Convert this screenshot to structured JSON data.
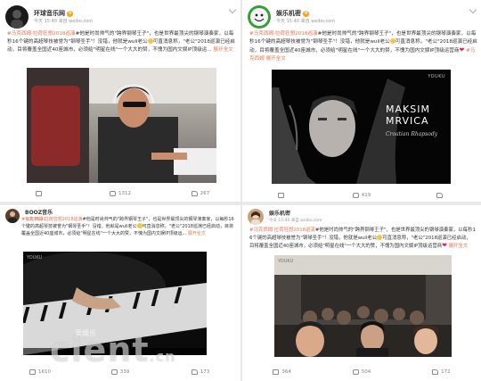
{
  "posts": [
    {
      "username": "环球音乐网",
      "verified": "V",
      "time": "今天 15:40",
      "source": "来自 weibo.com",
      "text_prefix": "#",
      "tag": "马克西姆·拉荷狂想2018巡演",
      "text": "#他是时尚帅气的\"跨界钢琴王子\"，也是世界最顶尖的钢琴演奏家，以每秒16个键的高超琴技被誉为\"钢琴圣手\"！没错，他就是wuli老公",
      "text2": "可直消息称，\"老公\"2018巡演已经启动，目将覆盖全国近40座城市，必须给\"明星在线\"一个大大的赞，不愧为国内文娱IP顶级运...",
      "more": "展开全文",
      "actions": {
        "share": "",
        "comment": "1312",
        "like": "267"
      },
      "avatar_color": "#1a1a1a"
    },
    {
      "username": "娱乐机密",
      "verified": "V",
      "time": "今天 15:40",
      "source": "来自 weibo.com",
      "text_prefix": "#",
      "tag": "马克西姆·拉荷狂想2018巡演",
      "text": "#他是时尚帅气的\"跨界钢琴王子\"，也是世界最顶尖的钢琴演奏家，以每秒16个键的高超琴技被誉为\"钢琴圣手\"！没错，他就是wuli老公",
      "text2": "可直消息称，\"老公\"2018巡演已经启动，目将覆盖全国近40座城市，必须给\"明星在线\"一个大大的赞，不愧为国内文娱IP顶级运营商",
      "tail_tag": "#马克西姆",
      "more": "展开全文",
      "poster_name": "MAKSIM",
      "poster_name2": "MRVICA",
      "poster_sub": "Croatian Rhapsody",
      "poster_logo": "YOUKU",
      "actions": {
        "share": "",
        "comment": "419",
        "like": ""
      },
      "avatar_color": "#3a9d3a"
    },
    {
      "username": "BOOZ音乐",
      "verified": "",
      "time": "今天 15:40",
      "source": "",
      "tag": "马克西姆·拉荷狂想2018巡演",
      "text": "#他是时尚帅气的\"跨界钢琴王子\"，也是世界最顶尖的钢琴演奏家，以每秒16个键的高超琴技被誉为\"钢琴圣手\"！没错，他就是wuli老公",
      "text2": "可直消息称，\"老公\"2018巡演已经启动，目将覆盖全国近40座城市，必须给\"明星在线\"一个大大的赞，不愧为国内文娱IP顶级运...",
      "more": "展开全文",
      "video_logo": "YOUKU",
      "video_caption": "爱娱乐",
      "actions": {
        "share": "1610",
        "comment": "339",
        "like": "173"
      },
      "avatar_color": "#5a3f2a"
    },
    {
      "username": "娱乐机密",
      "verified": "",
      "time": "今天 15:40",
      "source": "来自 weibo.com",
      "tag": "马克西姆·拉荷狂想2018巡演",
      "text": "#他是时尚帅气的\"跨界钢琴王子\"，也是世界最顶尖的钢琴演奏家，以每秒16个键的高超琴技被誉为\"钢琴圣手\"！没错，他就是wuli老公",
      "text2": "可直消息称，\"老公\"2018巡演已经启动，目将覆盖全国近40座城市，必须给\"明星在线\"一个大大的赞，不愧为国内文娱IP顶级运营商",
      "more": "展开全文",
      "video_logo": "YOUKU",
      "actions": {
        "share": "364",
        "comment": "504",
        "like": "172"
      },
      "avatar_color": "#c9a27a"
    }
  ],
  "watermark": {
    "brand": "cient",
    "suffix": ".cn"
  }
}
